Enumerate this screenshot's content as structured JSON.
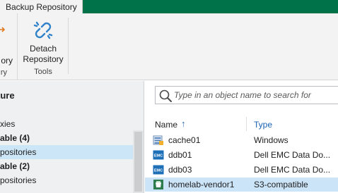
{
  "top_tab": {
    "label": "Backup Repository"
  },
  "ribbon": {
    "partial_button": {
      "label_line1": "ory",
      "label_line2": "ry"
    },
    "detach_button": {
      "line1": "Detach",
      "line2": "Repository",
      "icon": "broken-link-icon"
    },
    "group_label": "Tools"
  },
  "nav": {
    "title": "ture",
    "items": [
      {
        "label": "xies",
        "bold": false,
        "selected": false
      },
      {
        "label": "able (4)",
        "bold": true,
        "selected": false
      },
      {
        "label": "positories",
        "bold": false,
        "selected": true
      },
      {
        "label": "able (2)",
        "bold": true,
        "selected": false
      },
      {
        "label": "positories",
        "bold": false,
        "selected": false
      },
      {
        "label": "...",
        "bold": false,
        "selected": false
      }
    ]
  },
  "search": {
    "placeholder": "Type in an object name to search for"
  },
  "columns": {
    "name": "Name",
    "type": "Type",
    "sort_arrow": "↑"
  },
  "rows": [
    {
      "name": "cache01",
      "type": "Windows",
      "icon": "windows-server-icon",
      "selected": false
    },
    {
      "name": "ddb01",
      "type": "Dell EMC Data Do...",
      "icon": "emc-icon",
      "selected": false
    },
    {
      "name": "ddb03",
      "type": "Dell EMC Data Do...",
      "icon": "emc-icon",
      "selected": false
    },
    {
      "name": "homelab-vendor1",
      "type": "S3-compatible",
      "icon": "s3-bucket-icon",
      "selected": true
    }
  ],
  "colors": {
    "brand_green": "#00724a",
    "selection": "#cce4f7",
    "link_blue": "#1a62b3"
  }
}
